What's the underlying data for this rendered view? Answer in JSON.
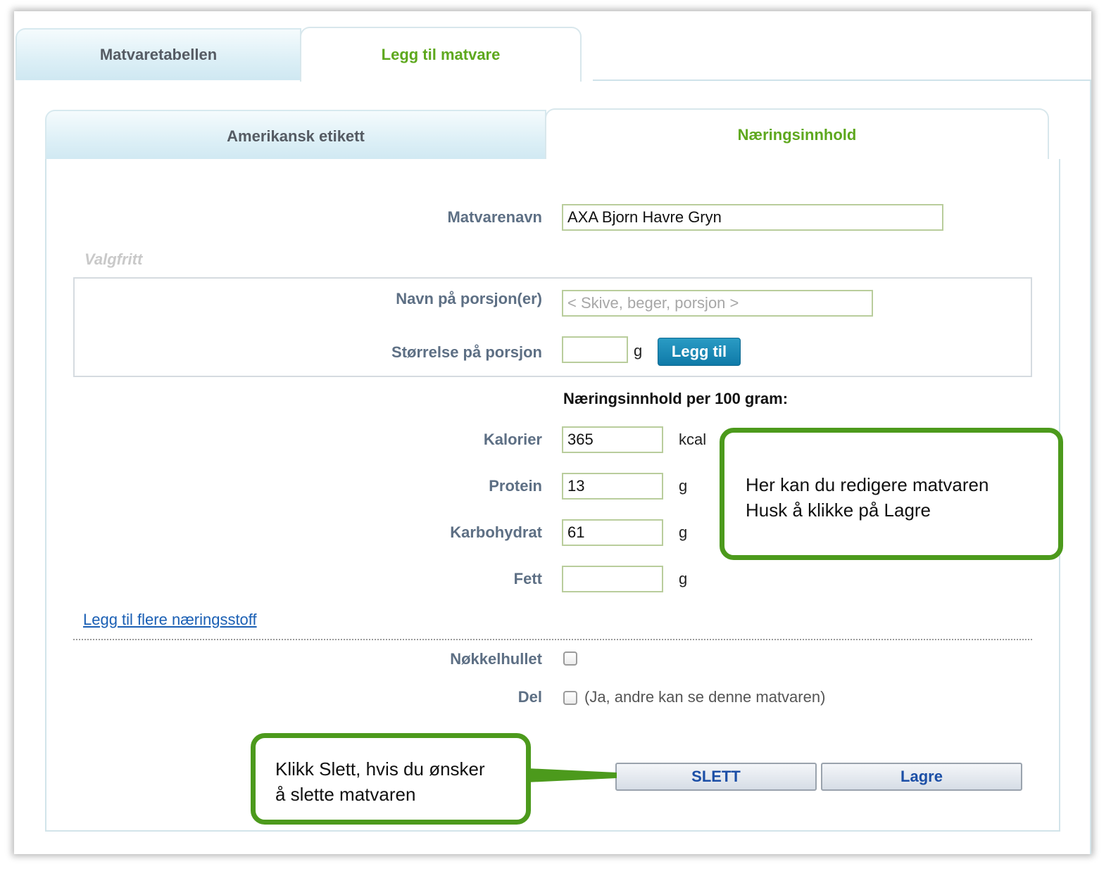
{
  "outer_tabs": [
    {
      "label": "Matvaretabellen",
      "active": false
    },
    {
      "label": "Legg til matvare",
      "active": true
    }
  ],
  "inner_tabs": [
    {
      "label": "Amerikansk etikett",
      "active": false
    },
    {
      "label": "Næringsinnhold",
      "active": true
    }
  ],
  "form": {
    "name_label": "Matvarenavn",
    "name_value": "AXA Bjorn Havre Gryn",
    "optional_label": "Valgfritt",
    "portion_name_label": "Navn på porsjon(er)",
    "portion_name_placeholder": "< Skive, beger, porsjon >",
    "portion_size_label": "Størrelse på porsjon",
    "portion_size_value": "",
    "portion_size_unit": "g",
    "add_button": "Legg til",
    "nutrition_heading": "Næringsinnhold per 100 gram:",
    "nutrients": [
      {
        "label": "Kalorier",
        "value": "365",
        "unit": "kcal"
      },
      {
        "label": "Protein",
        "value": "13",
        "unit": "g"
      },
      {
        "label": "Karbohydrat",
        "value": "61",
        "unit": "g"
      },
      {
        "label": "Fett",
        "value": "",
        "unit": "g"
      }
    ],
    "more_nutrients_link": "Legg til flere næringsstoff",
    "keyhole_label": "Nøkkelhullet",
    "keyhole_checked": false,
    "share_label": "Del",
    "share_checked": false,
    "share_note": "(Ja, andre kan se denne matvaren)",
    "delete_button": "SLETT",
    "save_button": "Lagre"
  },
  "callouts": {
    "edit_line1": "Her kan du redigere matvaren",
    "edit_line2": "Husk å klikke på Lagre",
    "delete_line1": "Klikk Slett, hvis du ønsker",
    "delete_line2": "å slette matvaren"
  },
  "colors": {
    "active_tab_text": "#5ea81e",
    "label_text": "#5d6f84",
    "callout_border": "#4c9a1c",
    "add_button_bg": "#1787b5",
    "link": "#1a5fb4"
  }
}
